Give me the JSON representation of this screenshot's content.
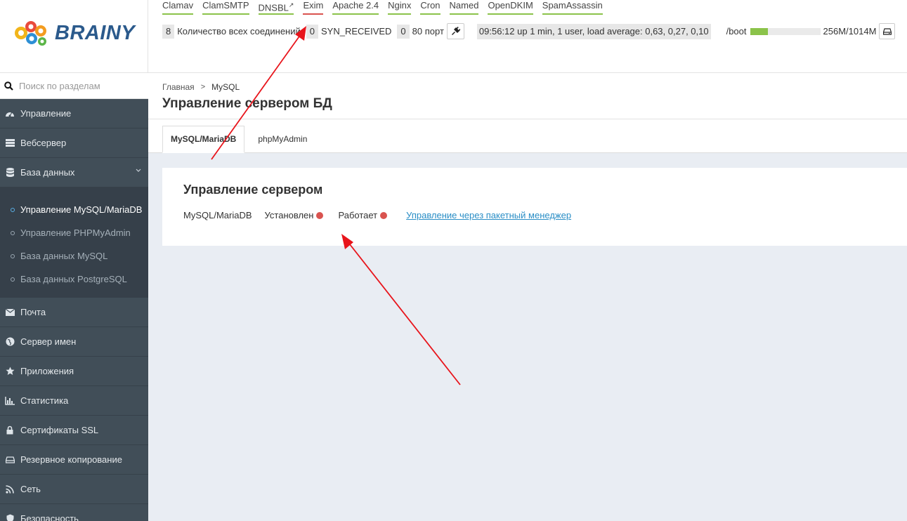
{
  "brand": {
    "name": "BRAINY"
  },
  "header": {
    "services": [
      {
        "label": "Clamav",
        "status": "ok"
      },
      {
        "label": "ClamSMTP",
        "status": "ok"
      },
      {
        "label": "DNSBL",
        "status": "ok",
        "external_icon": "external-link-icon"
      },
      {
        "label": "Exim",
        "status": "error"
      },
      {
        "label": "Apache 2.4",
        "status": "ok"
      },
      {
        "label": "Nginx",
        "status": "ok"
      },
      {
        "label": "Cron",
        "status": "ok"
      },
      {
        "label": "Named",
        "status": "ok"
      },
      {
        "label": "OpenDKIM",
        "status": "ok"
      },
      {
        "label": "SpamAssassin",
        "status": "ok"
      }
    ],
    "stats": {
      "connections_count": "8",
      "connections_label": "Количество всех соединений",
      "syn_count": "0",
      "syn_label": "SYN_RECEIVED",
      "port_count": "0",
      "port_label": "80 порт",
      "uptime": "09:56:12 up 1 min, 1 user, load average: 0,63, 0,27, 0,10",
      "disk_name": "/boot",
      "disk_size": "256M/1014M",
      "disk_used_fraction": 0.25
    },
    "colors": {
      "ok": "#8bc34a",
      "error": "#d9534f"
    }
  },
  "sidebar": {
    "search_placeholder": "Поиск по разделам",
    "items_top": [
      {
        "label": "Управление",
        "icon": "dashboard-icon"
      },
      {
        "label": "Вебсервер",
        "icon": "server-icon"
      },
      {
        "label": "База данных",
        "icon": "database-icon",
        "expanded": true
      }
    ],
    "subitems": [
      {
        "label": "Управление MySQL/MariaDB",
        "active": true
      },
      {
        "label": "Управление PHPMyAdmin"
      },
      {
        "label": "База данных MySQL"
      },
      {
        "label": "База данных PostgreSQL"
      }
    ],
    "items_bottom": [
      {
        "label": "Почта",
        "icon": "envelope-icon"
      },
      {
        "label": "Сервер имен",
        "icon": "globe-icon"
      },
      {
        "label": "Приложения",
        "icon": "star-icon"
      },
      {
        "label": "Статистика",
        "icon": "bar-chart-icon"
      },
      {
        "label": "Сертификаты SSL",
        "icon": "lock-icon"
      },
      {
        "label": "Резервное копирование",
        "icon": "hdd-icon"
      },
      {
        "label": "Сеть",
        "icon": "rss-icon"
      },
      {
        "label": "Безопасность",
        "icon": "shield-icon"
      }
    ]
  },
  "main": {
    "breadcrumb": {
      "home": "Главная",
      "separator": ">",
      "current": "MySQL"
    },
    "title": "Управление сервером БД",
    "tabs": [
      {
        "label": "MySQL/MariaDB",
        "active": true
      },
      {
        "label": "phpMyAdmin"
      }
    ],
    "panel": {
      "title": "Управление сервером",
      "service_name": "MySQL/MariaDB",
      "installed_label": "Установлен",
      "running_label": "Работает",
      "status_color": "#d9534f",
      "package_link": "Управление через пакетный менеджер"
    }
  },
  "annotations": {
    "arrow_color": "#e8141b"
  }
}
